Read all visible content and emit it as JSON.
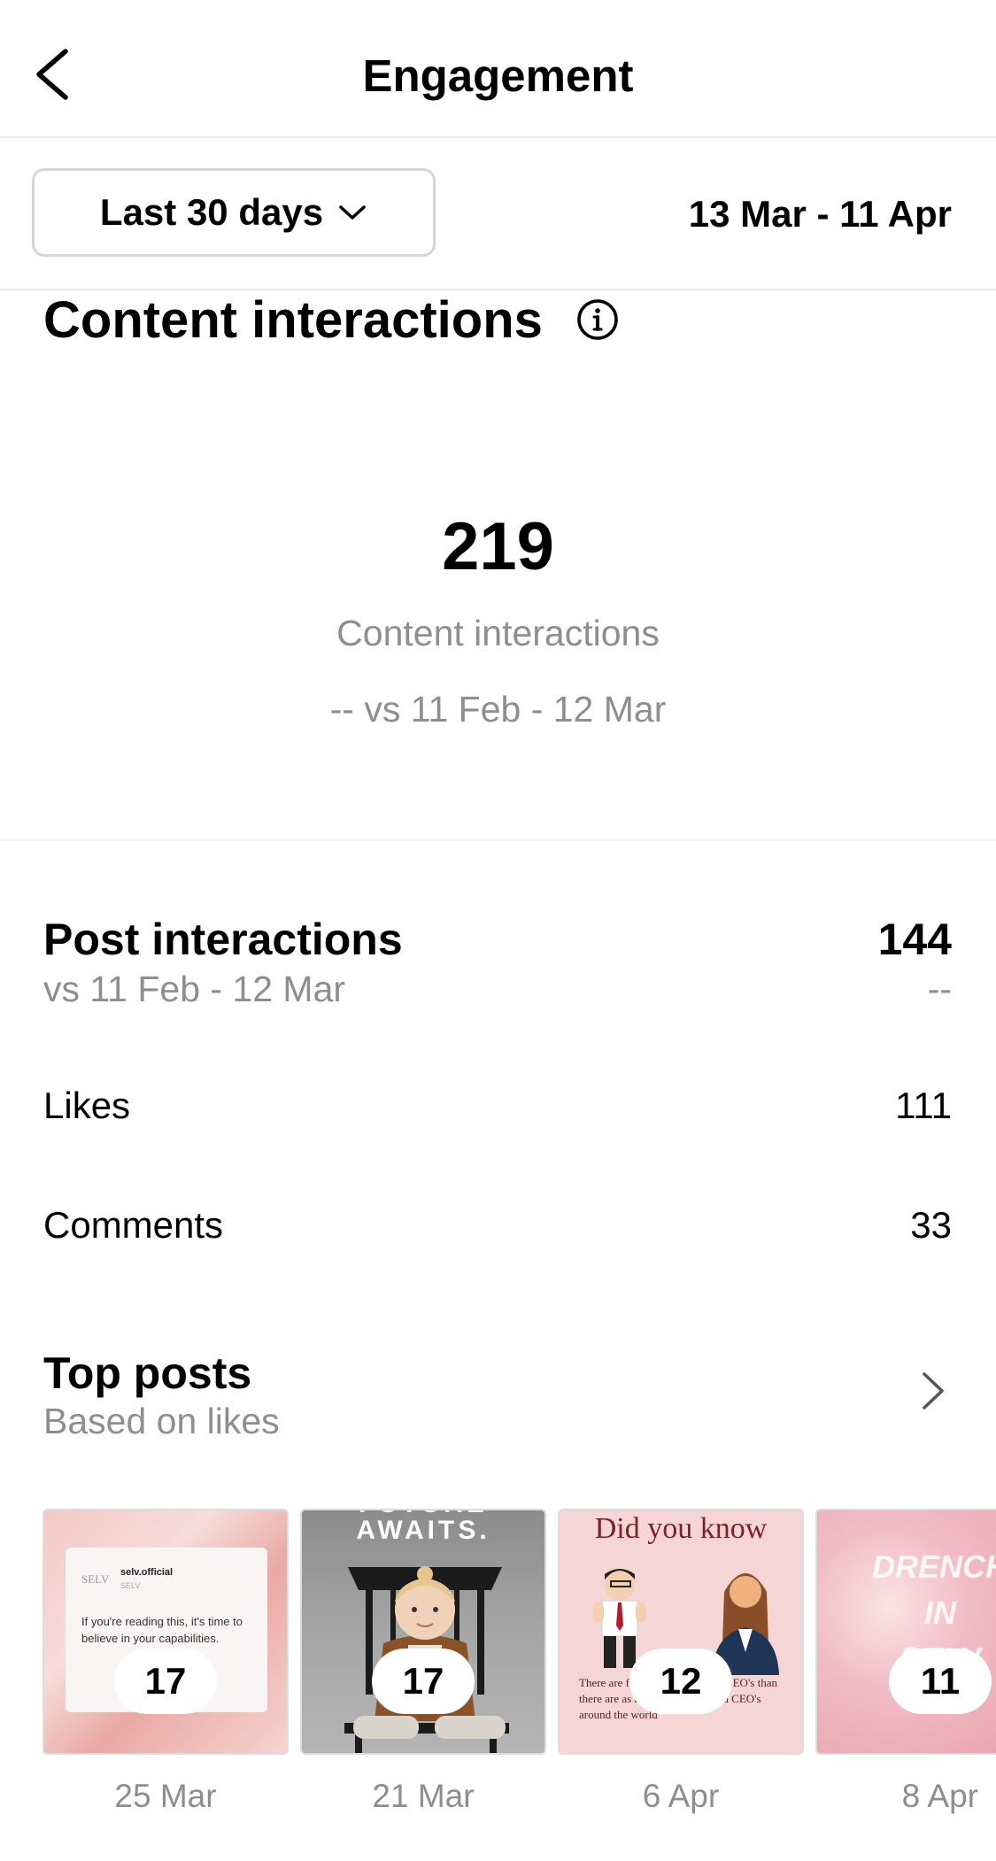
{
  "header": {
    "title": "Engagement",
    "back_icon": "chevron-left-icon"
  },
  "filter": {
    "range_label": "Last 30 days",
    "range_icon": "chevron-down-icon",
    "date_range": "13 Mar - 11 Apr"
  },
  "content_interactions": {
    "title": "Content interactions",
    "info_icon": "info-icon",
    "value": "219",
    "label": "Content interactions",
    "comparison": "-- vs 11 Feb - 12 Mar"
  },
  "post_interactions": {
    "title": "Post interactions",
    "comparison_label": "vs 11 Feb - 12 Mar",
    "value": "144",
    "change": "--",
    "rows": [
      {
        "label": "Likes",
        "value": "111"
      },
      {
        "label": "Comments",
        "value": "33"
      }
    ]
  },
  "top_posts": {
    "title": "Top posts",
    "subtitle": "Based on likes",
    "chevron_icon": "chevron-right-icon",
    "posts": [
      {
        "count": "17",
        "date": "25 Mar",
        "content": {
          "logo": "SELV",
          "handle": "selv.official",
          "handle_sub": "SELV",
          "text": "If you're reading this, it's time to believe in your capabilities."
        }
      },
      {
        "count": "17",
        "date": "21 Mar",
        "content": {
          "headline": "AWAITS.",
          "headline_top": "FUTURE"
        }
      },
      {
        "count": "12",
        "date": "6 Apr",
        "content": {
          "title": "Did you know",
          "text": "There are fewer women named CEO's than there are as much as men named CEO's around the world"
        }
      },
      {
        "count": "11",
        "date": "8 Apr",
        "content": {
          "text_lines": [
            "DRENCH",
            "IN",
            "SELV"
          ]
        }
      }
    ]
  }
}
